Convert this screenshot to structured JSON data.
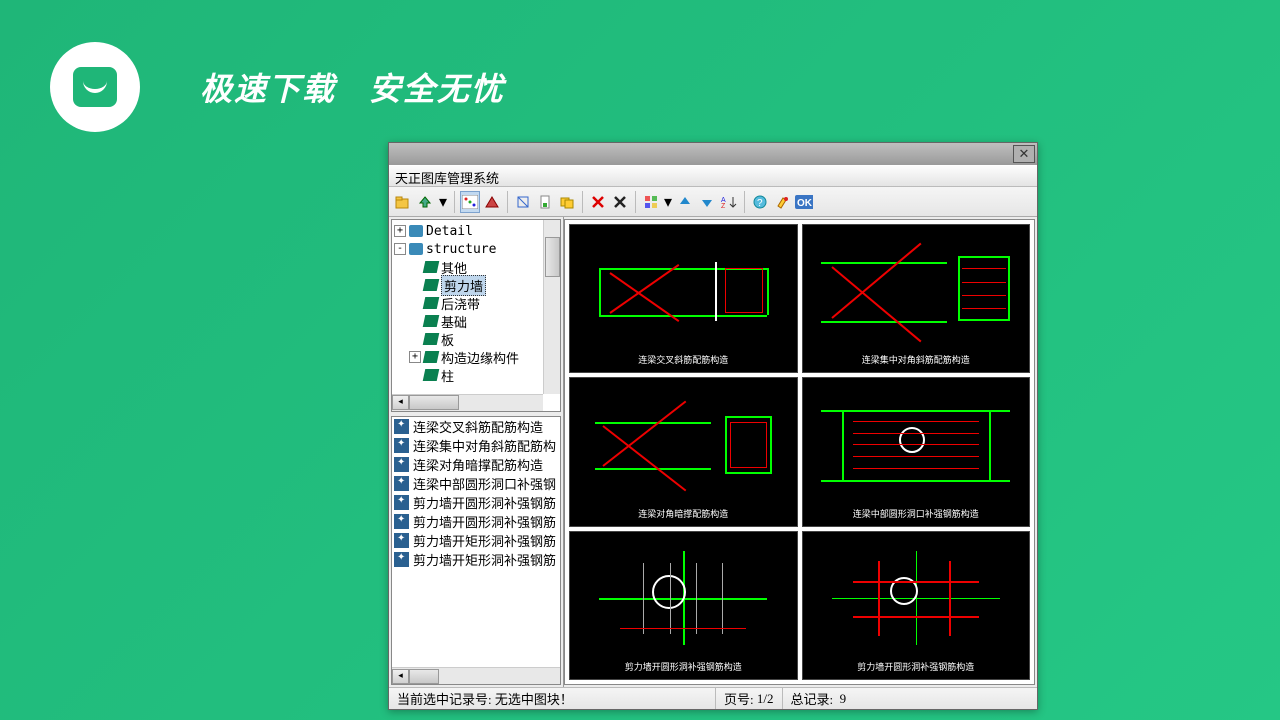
{
  "promo": {
    "text1": "极速下载",
    "text2": "安全无忧"
  },
  "window": {
    "title": "天正图库管理系统",
    "close": "✕"
  },
  "toolbar": {
    "open": "📂",
    "up": "⤴",
    "dropdown": "▾",
    "grid1": "⬚",
    "grid2": "⬛",
    "tool1": "⚙",
    "tool2": "📄",
    "tool3": "🗂",
    "delX1": "✕",
    "delX2": "✕",
    "group": "⊞",
    "arrow_up": "⬆",
    "arrow_down": "⬇",
    "sort": "A↓",
    "help": "?",
    "brush": "✎",
    "ok": "OK"
  },
  "tree": {
    "items": [
      {
        "expand": "+",
        "level": 0,
        "icon": "folder",
        "label": "Detail"
      },
      {
        "expand": "-",
        "level": 0,
        "icon": "folder",
        "label": "structure"
      },
      {
        "expand": "",
        "level": 1,
        "icon": "book",
        "label": "其他"
      },
      {
        "expand": "",
        "level": 1,
        "icon": "book",
        "label": "剪力墙",
        "selected": true
      },
      {
        "expand": "",
        "level": 1,
        "icon": "book",
        "label": "后浇带"
      },
      {
        "expand": "",
        "level": 1,
        "icon": "book",
        "label": "基础"
      },
      {
        "expand": "",
        "level": 1,
        "icon": "book",
        "label": "板"
      },
      {
        "expand": "+",
        "level": 1,
        "icon": "book",
        "label": "构造边缘构件"
      },
      {
        "expand": "",
        "level": 1,
        "icon": "book",
        "label": "柱"
      }
    ]
  },
  "list": {
    "items": [
      "连梁交叉斜筋配筋构造",
      "连梁集中对角斜筋配筋构",
      "连梁对角暗撑配筋构造",
      "连梁中部圆形洞口补强钢",
      "剪力墙开圆形洞补强钢筋",
      "剪力墙开圆形洞补强钢筋",
      "剪力墙开矩形洞补强钢筋",
      "剪力墙开矩形洞补强钢筋"
    ]
  },
  "thumbs": {
    "captions": [
      "连梁交叉斜筋配筋构造",
      "连梁集中对角斜筋配筋构造",
      "连梁对角暗撑配筋构造",
      "连梁中部圆形洞口补强钢筋构造",
      "剪力墙开圆形洞补强钢筋构造",
      "剪力墙开圆形洞补强钢筋构造"
    ]
  },
  "status": {
    "label": "当前选中记录号:",
    "value": "无选中图块！",
    "page_label": "页号:",
    "page_value": "1/2",
    "total_label": "总记录:",
    "total_value": "9"
  }
}
